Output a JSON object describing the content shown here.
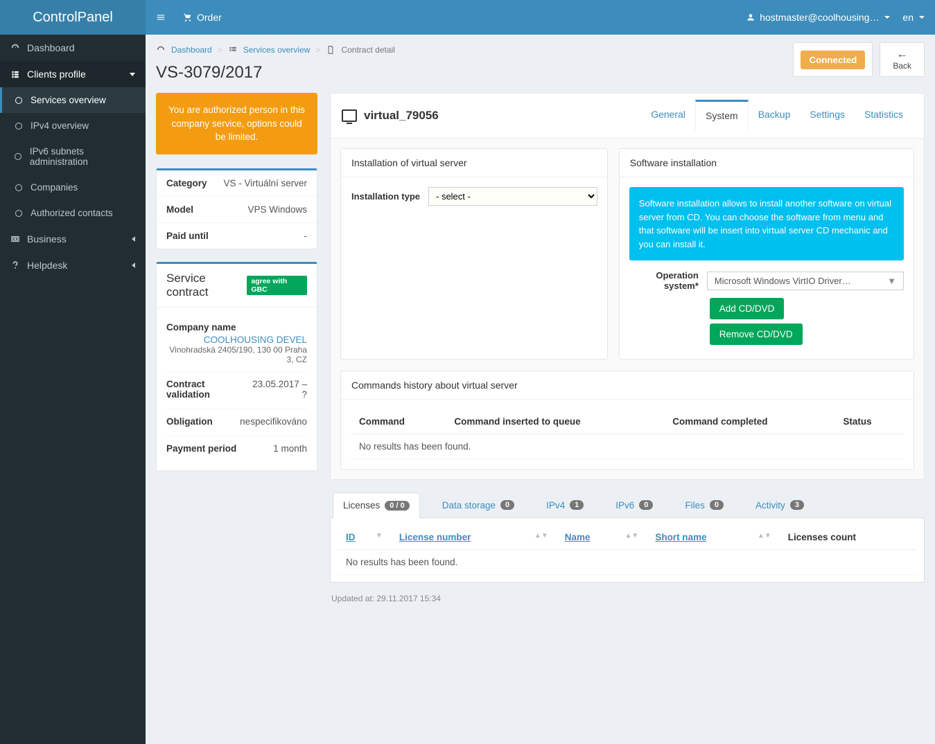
{
  "brand": "ControlPanel",
  "topbar": {
    "order": "Order",
    "user": "hostmaster@coolhousing…",
    "lang": "en"
  },
  "sidebar": {
    "dashboard": "Dashboard",
    "clients_profile": "Clients profile",
    "items": [
      "Services overview",
      "IPv4 overview",
      "IPv6 subnets administration",
      "Companies",
      "Authorized contacts"
    ],
    "business": "Business",
    "helpdesk": "Helpdesk"
  },
  "breadcrumb": {
    "dashboard": "Dashboard",
    "services": "Services overview",
    "detail": "Contract detail"
  },
  "page_title": "VS-3079/2017",
  "actions": {
    "connected": "Connected",
    "back": "Back"
  },
  "warn": "You are authorized person in this company service, options could be limited.",
  "details": {
    "category_k": "Category",
    "category_v": "VS - Virtuální server",
    "model_k": "Model",
    "model_v": "VPS Windows",
    "paid_k": "Paid until",
    "paid_v": "-"
  },
  "contract": {
    "title": "Service contract",
    "badge": "agree with GBC",
    "company_k": "Company name",
    "company_v": "COOLHOUSING DEVEL",
    "company_addr": "Vinohradská 2405/190, 130 00 Praha 3, CZ",
    "valid_k": "Contract validation",
    "valid_v": "23.05.2017 – ?",
    "oblig_k": "Obligation",
    "oblig_v": "nespecifikováno",
    "period_k": "Payment period",
    "period_v": "1 month"
  },
  "virtual": {
    "name": "virtual_79056",
    "tabs": {
      "general": "General",
      "system": "System",
      "backup": "Backup",
      "settings": "Settings",
      "statistics": "Statistics"
    },
    "install": {
      "title": "Installation of virtual server",
      "type_lbl": "Installation type",
      "type_val": "- select -"
    },
    "software": {
      "title": "Software installation",
      "info": "Software installation allows to install another software on virtual server from CD. You can choose the software from menu and that software will be insert into virtual server CD mechanic and you can install it.",
      "os_lbl": "Operation system*",
      "os_val": "Microsoft Windows VirtIO Driver…",
      "add": "Add CD/DVD",
      "remove": "Remove CD/DVD"
    },
    "history": {
      "title": "Commands history about virtual server",
      "cols": {
        "cmd": "Command",
        "ins": "Command inserted to queue",
        "done": "Command completed",
        "status": "Status"
      },
      "empty": "No results has been found."
    }
  },
  "bottom": {
    "tabs": {
      "licenses": {
        "label": "Licenses",
        "count": "0 / 0"
      },
      "storage": {
        "label": "Data storage",
        "count": "0"
      },
      "ipv4": {
        "label": "IPv4",
        "count": "1"
      },
      "ipv6": {
        "label": "IPv6",
        "count": "0"
      },
      "files": {
        "label": "Files",
        "count": "0"
      },
      "activity": {
        "label": "Activity",
        "count": "3"
      }
    },
    "lic_cols": {
      "id": "ID",
      "num": "License number",
      "name": "Name",
      "short": "Short name",
      "count": "Licenses count"
    },
    "empty": "No results has been found."
  },
  "footer": "Updated at: 29.11.2017 15:34"
}
